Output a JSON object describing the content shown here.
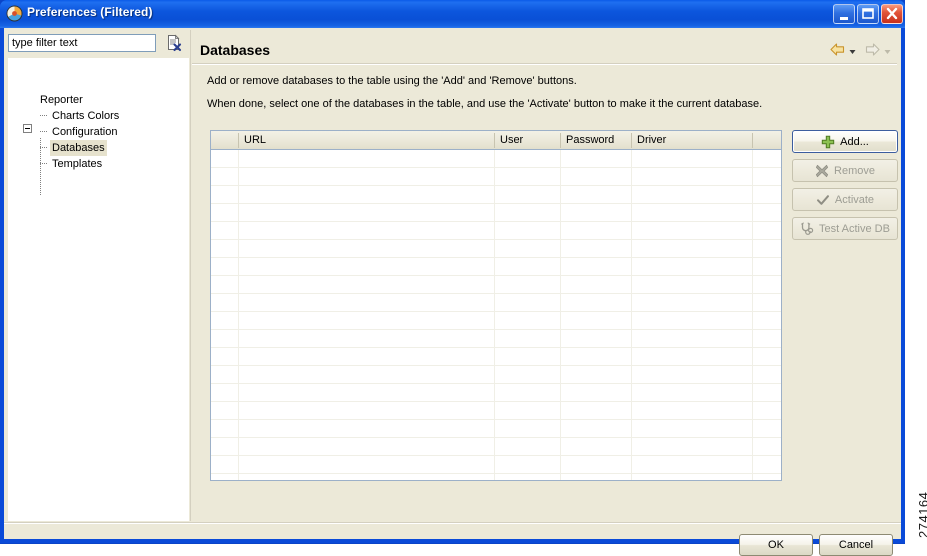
{
  "window": {
    "title": "Preferences (Filtered)",
    "icon": "eclipse-preferences-icon",
    "minimize_label": "Minimize",
    "maximize_label": "Maximize",
    "close_label": "Close"
  },
  "filter": {
    "value": "type filter text",
    "placeholder": "type filter text",
    "clear_icon": "clear-filter-icon"
  },
  "tree": {
    "root": {
      "label": "Reporter",
      "expanded": true
    },
    "items": [
      {
        "label": "Charts Colors",
        "selected": false
      },
      {
        "label": "Configuration",
        "selected": false
      },
      {
        "label": "Databases",
        "selected": true
      },
      {
        "label": "Templates",
        "selected": false
      }
    ]
  },
  "page": {
    "title": "Databases",
    "description_line1": "Add or remove databases to the table using the 'Add' and 'Remove' buttons.",
    "description_line2": "When done, select one of the databases in the table, and use the 'Activate' button to make it the current database.",
    "nav": {
      "back_icon": "back-arrow-icon",
      "back_caret_icon": "chevron-down-icon",
      "forward_icon": "forward-arrow-icon",
      "forward_caret_icon": "chevron-down-icon"
    }
  },
  "table": {
    "columns": [
      "",
      "URL",
      "User",
      "Password",
      "Driver",
      ""
    ],
    "rows": [],
    "empty_row_count": 18
  },
  "side_buttons": [
    {
      "label": "Add...",
      "icon": "plus-icon",
      "enabled": true,
      "focused": true
    },
    {
      "label": "Remove",
      "icon": "x-mark-icon",
      "enabled": false,
      "focused": false
    },
    {
      "label": "Activate",
      "icon": "check-icon",
      "enabled": false,
      "focused": false
    },
    {
      "label": "Test Active DB",
      "icon": "stethoscope-icon",
      "enabled": false,
      "focused": false
    }
  ],
  "dialog_buttons": {
    "ok": "OK",
    "cancel": "Cancel"
  },
  "figure_number": "274164",
  "colors": {
    "window_chrome": "#0a4ad8",
    "dialog_background": "#ece9d8",
    "tree_background": "#ffffff",
    "selection": "#e6e2cd",
    "table_border": "#9cb0c8",
    "focus_border": "#3c5d9e",
    "add_icon_green": "#7bb648",
    "close_button_red": "#c7301b",
    "back_arrow_orange": "#e8b84b"
  }
}
